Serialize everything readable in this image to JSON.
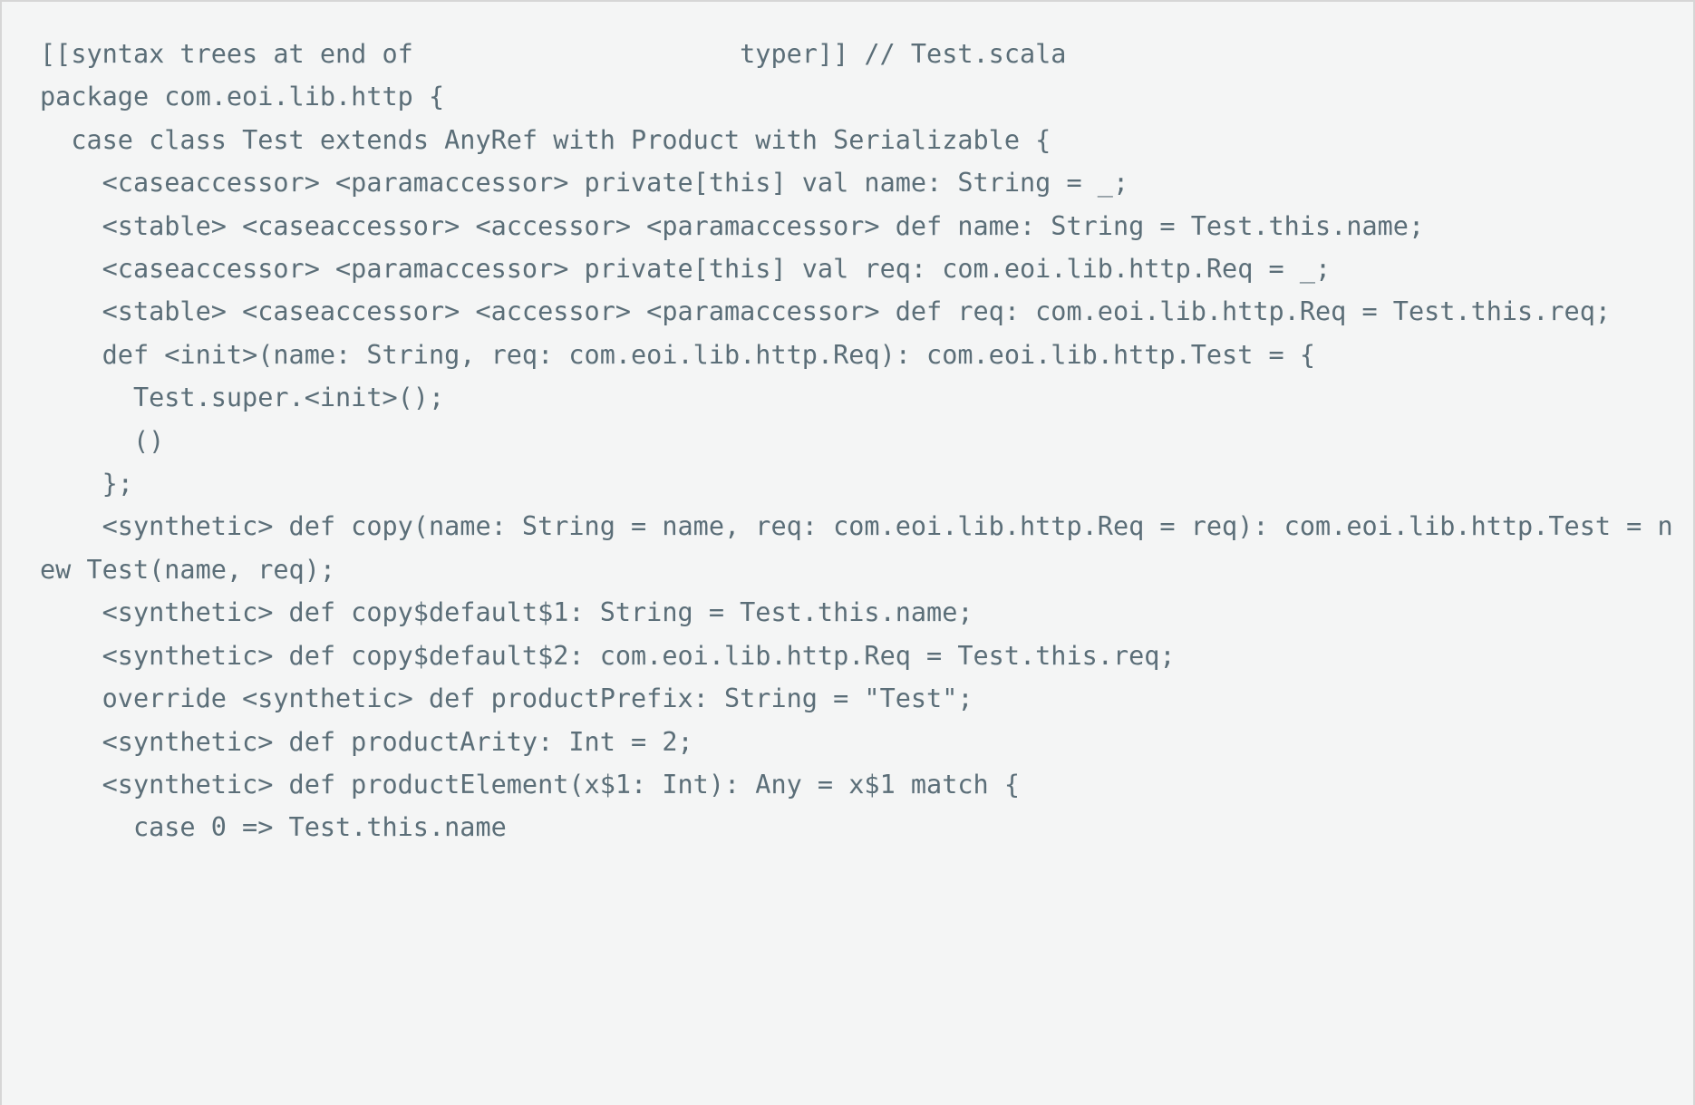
{
  "window": {
    "title": "[[syntax trees at end of                     typer]] // Test.scala",
    "background_color": "#f4f5f5",
    "text_color": "#5b6e78",
    "border_color": "#d6d6d6"
  },
  "code": {
    "language": "scala",
    "source_file": "Test.scala",
    "phase": "typer",
    "header": "[[syntax trees at end of                     typer]] // Test.scala",
    "lines": [
      "[[syntax trees at end of                     typer]] // Test.scala",
      "package com.eoi.lib.http {",
      "  case class Test extends AnyRef with Product with Serializable {",
      "    <caseaccessor> <paramaccessor> private[this] val name: String = _;",
      "    <stable> <caseaccessor> <accessor> <paramaccessor> def name: String = Test.this.name;",
      "    <caseaccessor> <paramaccessor> private[this] val req: com.eoi.lib.http.Req = _;",
      "    <stable> <caseaccessor> <accessor> <paramaccessor> def req: com.eoi.lib.http.Req = Test.this.req;",
      "    def <init>(name: String, req: com.eoi.lib.http.Req): com.eoi.lib.http.Test = {",
      "      Test.super.<init>();",
      "      ()",
      "    };",
      "    <synthetic> def copy(name: String = name, req: com.eoi.lib.http.Req = req): com.eoi.lib.http.Test = new Test(name, req);",
      "    <synthetic> def copy$default$1: String = Test.this.name;",
      "    <synthetic> def copy$default$2: com.eoi.lib.http.Req = Test.this.req;",
      "    override <synthetic> def productPrefix: String = \"Test\";",
      "    <synthetic> def productArity: Int = 2;",
      "    <synthetic> def productElement(x$1: Int): Any = x$1 match {",
      "      case 0 => Test.this.name"
    ],
    "text": "[[syntax trees at end of                     typer]] // Test.scala\npackage com.eoi.lib.http {\n  case class Test extends AnyRef with Product with Serializable {\n    <caseaccessor> <paramaccessor> private[this] val name: String = _;\n    <stable> <caseaccessor> <accessor> <paramaccessor> def name: String = Test.this.name;\n    <caseaccessor> <paramaccessor> private[this] val req: com.eoi.lib.http.Req = _;\n    <stable> <caseaccessor> <accessor> <paramaccessor> def req: com.eoi.lib.http.Req = Test.this.req;\n    def <init>(name: String, req: com.eoi.lib.http.Req): com.eoi.lib.http.Test = {\n      Test.super.<init>();\n      ()\n    };\n    <synthetic> def copy(name: String = name, req: com.eoi.lib.http.Req = req): com.eoi.lib.http.Test = new Test(name, req);\n    <synthetic> def copy$default$1: String = Test.this.name;\n    <synthetic> def copy$default$2: com.eoi.lib.http.Req = Test.this.req;\n    override <synthetic> def productPrefix: String = \"Test\";\n    <synthetic> def productArity: Int = 2;\n    <synthetic> def productElement(x$1: Int): Any = x$1 match {\n      case 0 => Test.this.name"
  }
}
